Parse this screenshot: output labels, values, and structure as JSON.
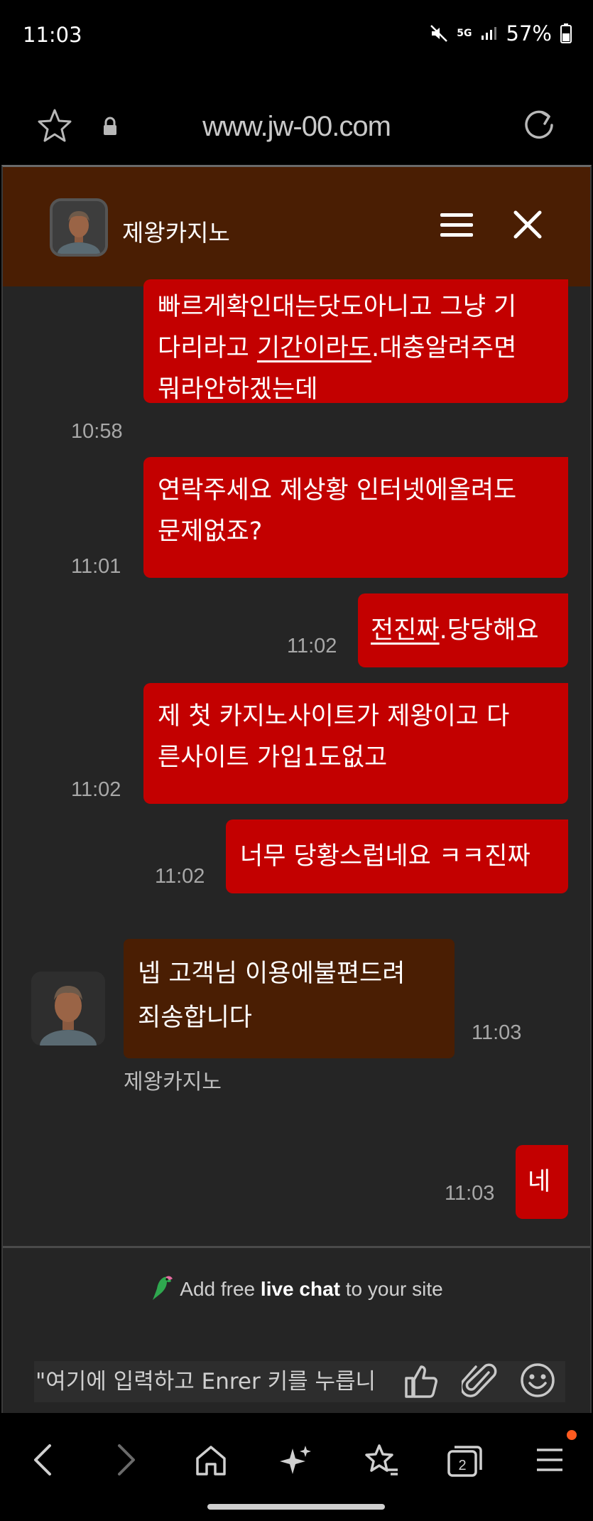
{
  "status_bar": {
    "time": "11:03",
    "network": "5G",
    "battery": "57%"
  },
  "browser": {
    "url": "www.jw-00.com"
  },
  "chat": {
    "title": "제왕카지노",
    "agent_name": "제왕카지노",
    "messages": [
      {
        "dir": "out",
        "time": "10:58",
        "lines": [
          [
            "빠르게확인대는닷도아니고 그냥 기"
          ],
          [
            "다리라고 ",
            {
              "u": "기간이라도"
            },
            ".대충알려주면"
          ],
          [
            "뭐라안하겠는데"
          ]
        ]
      },
      {
        "dir": "out",
        "time": "11:01",
        "lines": [
          [
            "연락주세요 제상황 인터넷에올려도"
          ],
          [
            "문제없죠?"
          ]
        ]
      },
      {
        "dir": "out",
        "time": "11:02",
        "lines": [
          [
            {
              "u": "전진짜"
            },
            ".당당해요"
          ]
        ]
      },
      {
        "dir": "out",
        "time": "11:02",
        "lines": [
          [
            "제 첫 카지노사이트가 제왕이고 다"
          ],
          [
            "른사이트 가입1도없고"
          ]
        ]
      },
      {
        "dir": "out",
        "time": "11:02",
        "lines": [
          [
            "너무 당황스럽네요 ㅋㅋ진짜"
          ]
        ]
      },
      {
        "dir": "in",
        "time": "11:03",
        "lines": [
          [
            "넵 고객님 이용에불편드려"
          ],
          [
            "죄송합니다"
          ]
        ]
      },
      {
        "dir": "out",
        "time": "11:03",
        "lines": [
          [
            "네"
          ]
        ]
      }
    ],
    "powered_by": {
      "prefix": "Add free ",
      "bold": "live chat",
      "suffix": " to your site"
    },
    "input": {
      "placeholder": "\"여기에 입력하고 Enrer 키를 누릅니"
    }
  },
  "colors": {
    "header_bg": "#4a1e03",
    "outgoing_bubble": "#c30000",
    "incoming_bubble": "#4a1e03",
    "chat_bg": "#252525"
  },
  "icons": [
    "star-icon",
    "lock-icon",
    "reload-icon",
    "menu-icon",
    "close-icon",
    "thumbs-up-icon",
    "paperclip-icon",
    "emoji-icon",
    "back-icon",
    "forward-icon",
    "home-icon",
    "sparkle-icon",
    "bookmarks-icon",
    "tabs-icon",
    "nav-menu-icon"
  ],
  "nav": {
    "tabs_count": "2"
  }
}
